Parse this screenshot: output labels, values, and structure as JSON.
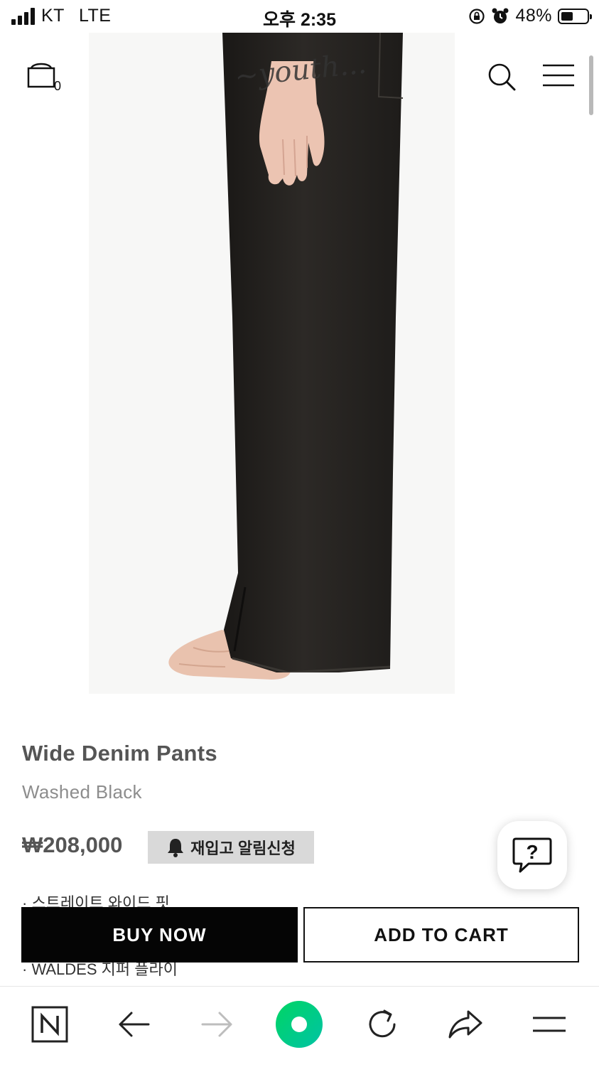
{
  "status_bar": {
    "carrier": "KT",
    "network": "LTE",
    "time": "오후 2:35",
    "battery_percent": "48%",
    "battery_level": 0.48
  },
  "header": {
    "cart_count": "0",
    "icons": [
      "bag-icon",
      "search-icon",
      "hamburger-menu-icon"
    ]
  },
  "product": {
    "name": "Wide Denim Pants",
    "color": "Washed Black",
    "price": "₩208,000",
    "restock_button": "재입고 알림신청",
    "features": [
      "· 스트레이트 와이드 핏",
      "· WALDES 지퍼 플라이"
    ]
  },
  "actions": {
    "buy_now": "BUY NOW",
    "add_to_cart": "ADD TO CART"
  },
  "help": {
    "icon": "question-chat-icon",
    "label": "?"
  },
  "browser_toolbar": {
    "icons": [
      "naver-icon",
      "back-arrow-icon",
      "forward-arrow-icon",
      "home-green-ring-icon",
      "refresh-icon",
      "share-icon",
      "menu-icon"
    ],
    "home_color": "#1ec800"
  },
  "colors": {
    "buy_bg": "#050505",
    "restock_bg": "#d9d9d9",
    "text_gray": "#555555"
  }
}
